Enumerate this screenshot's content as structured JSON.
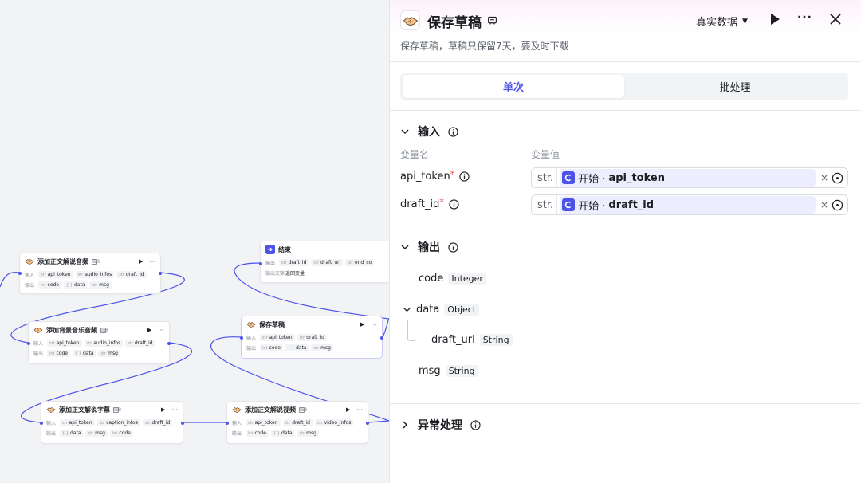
{
  "canvas": {
    "nodes": [
      {
        "title": "添加正文解说音频",
        "input_label": "输入",
        "output_label": "输出",
        "inputs": [
          {
            "t": "str",
            "v": "api_token"
          },
          {
            "t": "str",
            "v": "audio_infos"
          },
          {
            "t": "str",
            "v": "draft_id"
          }
        ],
        "outputs": [
          {
            "t": "int",
            "v": "code"
          },
          {
            "t": "{ }",
            "v": "data"
          },
          {
            "t": "str",
            "v": "msg"
          }
        ]
      },
      {
        "title": "添加背景音乐音频",
        "input_label": "输入",
        "output_label": "输出",
        "inputs": [
          {
            "t": "str",
            "v": "api_token"
          },
          {
            "t": "str",
            "v": "audio_infos"
          },
          {
            "t": "str",
            "v": "draft_id"
          }
        ],
        "outputs": [
          {
            "t": "int",
            "v": "code"
          },
          {
            "t": "{ }",
            "v": "data"
          },
          {
            "t": "str",
            "v": "msg"
          }
        ]
      },
      {
        "title": "添加正文解说字幕",
        "input_label": "输入",
        "output_label": "输出",
        "inputs": [
          {
            "t": "str",
            "v": "api_token"
          },
          {
            "t": "str",
            "v": "caption_infos"
          },
          {
            "t": "str",
            "v": "draft_id"
          }
        ],
        "outputs": [
          {
            "t": "{ }",
            "v": "data"
          },
          {
            "t": "str",
            "v": "msg"
          },
          {
            "t": "int",
            "v": "code"
          }
        ]
      },
      {
        "title": "添加正文解说视频",
        "input_label": "输入",
        "output_label": "输出",
        "inputs": [
          {
            "t": "str",
            "v": "api_token"
          },
          {
            "t": "str",
            "v": "draft_id"
          },
          {
            "t": "str",
            "v": "video_infos"
          }
        ],
        "outputs": [
          {
            "t": "int",
            "v": "code"
          },
          {
            "t": "{ }",
            "v": "data"
          },
          {
            "t": "str",
            "v": "msg"
          }
        ]
      },
      {
        "title": "保存草稿",
        "input_label": "输入",
        "output_label": "输出",
        "inputs": [
          {
            "t": "str",
            "v": "api_token"
          },
          {
            "t": "str",
            "v": "draft_id"
          }
        ],
        "outputs": [
          {
            "t": "int",
            "v": "code"
          },
          {
            "t": "{ }",
            "v": "data"
          },
          {
            "t": "str",
            "v": "msg"
          }
        ]
      },
      {
        "title": "结束",
        "input_label": "输出",
        "output_label": "输出文案",
        "inputs": [
          {
            "t": "str",
            "v": "draft_id"
          },
          {
            "t": "str",
            "v": "draft_url"
          },
          {
            "t": "str",
            "v": "end_co"
          }
        ],
        "output_text": "返回变量"
      }
    ]
  },
  "panel": {
    "title": "保存草稿",
    "description": "保存草稿，草稿只保留7天，要及时下载",
    "data_mode": "真实数据",
    "tabs": [
      {
        "label": "单次",
        "active": true
      },
      {
        "label": "批处理",
        "active": false
      }
    ],
    "input_section": {
      "title": "输入",
      "col_name": "变量名",
      "col_value": "变量值",
      "params": [
        {
          "name": "api_token",
          "type": "str.",
          "source": "开始 ·",
          "var": "api_token"
        },
        {
          "name": "draft_id",
          "type": "str.",
          "source": "开始 ·",
          "var": "draft_id"
        }
      ]
    },
    "output_section": {
      "title": "输出",
      "fields": [
        {
          "name": "code",
          "type": "Integer"
        },
        {
          "name": "data",
          "type": "Object"
        },
        {
          "name": "draft_url",
          "type": "String"
        },
        {
          "name": "msg",
          "type": "String"
        }
      ]
    },
    "exception_section": {
      "title": "异常处理"
    }
  },
  "colors": {
    "accent": "#4d53e8",
    "required": "#f54a45",
    "canvas_bg": "#f2f3f5",
    "edge": "#4d53e8"
  }
}
